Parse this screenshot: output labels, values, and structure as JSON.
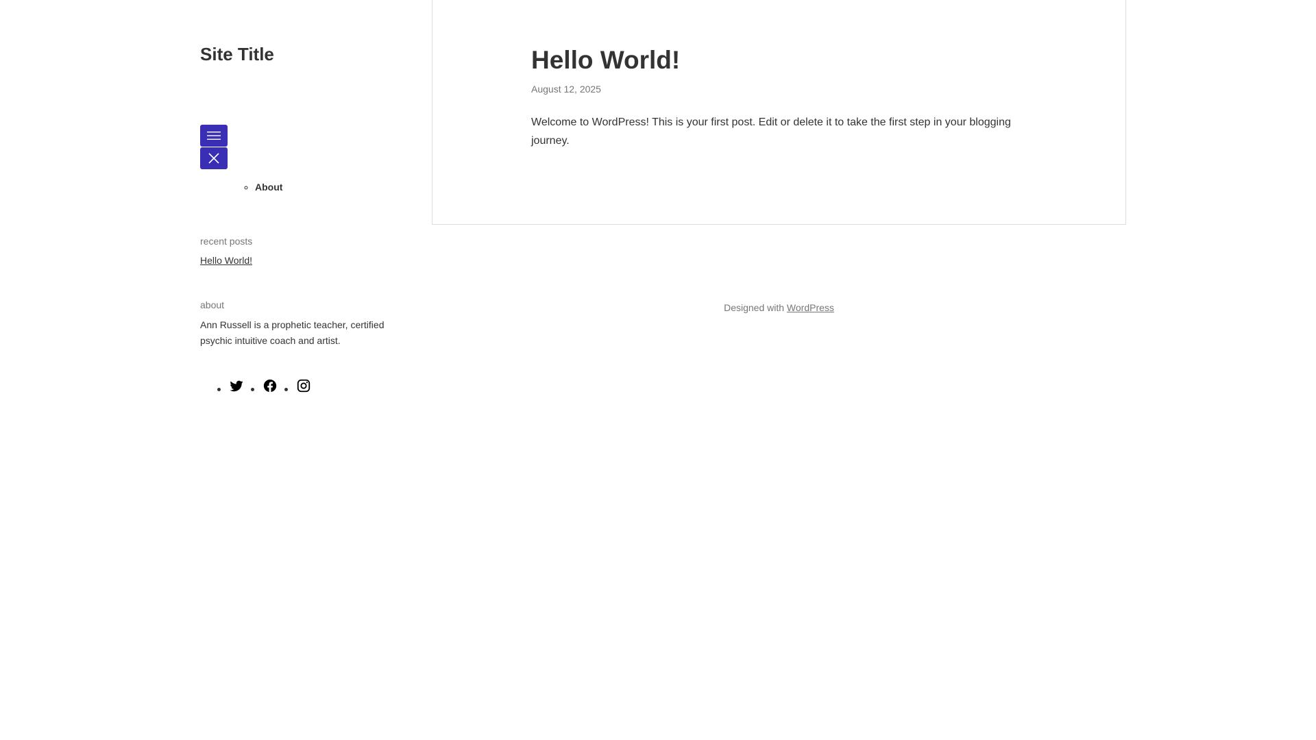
{
  "site": {
    "title": "Site Title"
  },
  "navigation": {
    "open_button_icon": "menu-icon",
    "close_button_icon": "close-icon",
    "items": [
      {
        "label": "About"
      }
    ]
  },
  "widgets": {
    "recent_posts": {
      "title": "recent posts",
      "items": [
        {
          "label": "Hello World!"
        }
      ]
    },
    "about": {
      "title": "about",
      "text": "Ann Russell is a prophetic teacher, certified psychic intuitive coach and artist."
    },
    "social": [
      {
        "icon": "twitter-icon"
      },
      {
        "icon": "facebook-icon"
      },
      {
        "icon": "instagram-icon"
      }
    ]
  },
  "post": {
    "title": "Hello World!",
    "date": "August 12, 2025",
    "content": "Welcome to WordPress! This is your first post. Edit or delete it to take the first step in your blogging journey."
  },
  "footer": {
    "prefix": "Designed with ",
    "link_label": "WordPress"
  },
  "colors": {
    "accent": "#3a2fb4",
    "text": "#333333",
    "muted": "#767676",
    "border": "#dddddd"
  }
}
